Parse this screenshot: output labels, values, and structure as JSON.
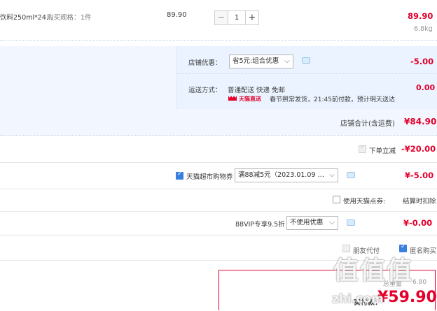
{
  "product": {
    "name": "饮料250ml*24…",
    "spec_label": "购买规格：",
    "spec_value": "1件",
    "unit_price": "89.90",
    "quantity": "1",
    "qty_minus": "−",
    "qty_plus": "+",
    "subtotal": "89.90",
    "weight": "6.8kg"
  },
  "shop": {
    "discount_label": "店铺优惠：",
    "discount_option": "省5元:组合优惠",
    "discount_amount": "-5.00",
    "shipping_label": "运送方式：",
    "shipping_method": "普通配送 快递 免邮",
    "tmall_badge": "天猫直送",
    "shipping_note": "春节照常发货，21:45前付款，预计明天送达",
    "shipping_amount": "0.00",
    "total_label": "店铺合计(含运费)",
    "total_amount": "¥84.90"
  },
  "promos": {
    "instant_label": "下单立减",
    "instant_amount": "-¥20.00",
    "coupon_label": "天猫超市购物券",
    "coupon_option": "满88减5元（2023.01.09 …",
    "coupon_amount": "¥-5.00",
    "points_label": "使用天猫点券:",
    "points_note": "结算时扣除",
    "vip_label": "88VIP专享9.5折",
    "vip_option": "不使用优惠",
    "vip_amount": "¥-0.00",
    "friend_pay_label": "朋友代付",
    "anonymous_label": "匿名购买"
  },
  "payment": {
    "weight_label": "总重量",
    "weight_value": "6.80",
    "pay_label": "实付款：",
    "pay_amount": "¥59.90"
  },
  "watermark": {
    "logo": "值值值",
    "domain": "zhi.com"
  },
  "colors": {
    "price_red": "#e4002b",
    "shop_bg": "#f2f7ff",
    "check_blue": "#3a7fe0"
  }
}
